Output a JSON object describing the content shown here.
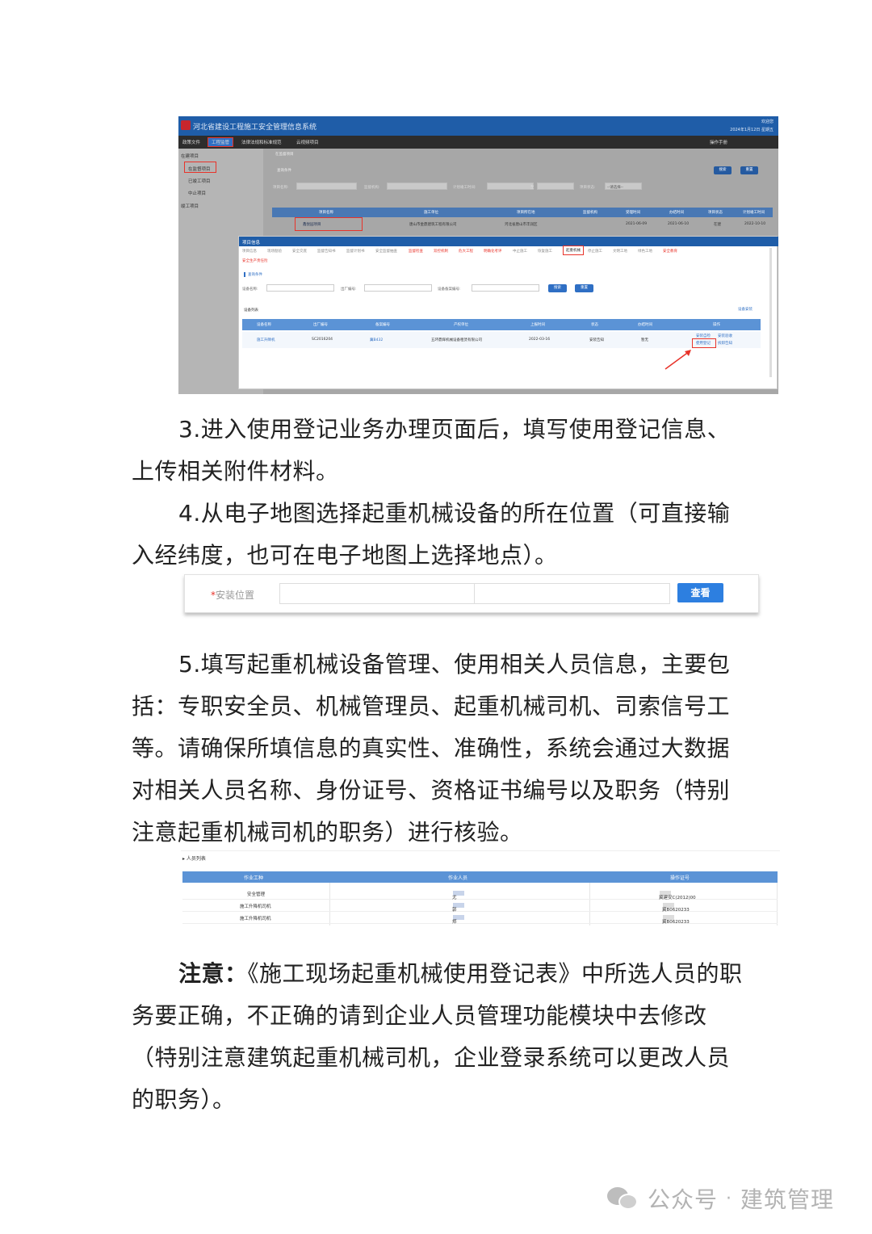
{
  "shot1": {
    "app_title": "河北省建设工程施工安全管理信息系统",
    "top_right_line1": "欢迎您",
    "top_right_line2": "2024年1月12日 星期五",
    "top_right_line3": "操作手册",
    "menu": [
      "政策文件",
      "工程监管",
      "法律法规和标准规范",
      "云视频项目"
    ],
    "menu_active_index": 1,
    "leftnav": [
      "在建项目",
      "在监督项目",
      "已竣工项目",
      "中止项目",
      "竣工项目"
    ],
    "breadcrumb_tab": "在监督项目",
    "query_label": "查询条件",
    "filters": [
      "项目名称:",
      "监督机构:",
      "计划竣工时间:",
      "至",
      "项目状态:",
      "--请选择--"
    ],
    "search_btn": "搜索",
    "reset_btn": "重置",
    "proj_columns": [
      "项目名称",
      "施工单位",
      "项目所在地",
      "监督机构",
      "受理时间",
      "办结时间",
      "项目状态",
      "计划竣工时间"
    ],
    "proj_row": [
      "鑫悦园项目",
      "唐山市金鼎建筑工程有限公司",
      "河北省唐山市丰润区",
      "",
      "2021-06-09",
      "2021-06-10",
      "在建",
      "2022-10-10"
    ],
    "modal_title": "项目信息",
    "modal_tabs": [
      "项目信息",
      "现场勘验",
      "安全交底",
      "监督告知书",
      "监督计划书",
      "安全监督抽查",
      "监督检查",
      "双控机制",
      "危大工程",
      "明确化考评",
      "中止施工",
      "恢复施工",
      "起重机械",
      "停止施工",
      "文明工地",
      "绿色工地",
      "安全教育",
      "安全生产责任险"
    ],
    "modal_tab_red": [
      6,
      7,
      8,
      9,
      16,
      17
    ],
    "modal_tab_active": 12,
    "modal_query_label": "查询条件",
    "modal_filters": [
      "设备名称:",
      "出厂编号:",
      "设备备案编号:"
    ],
    "device_list_label": "设备列表",
    "device_add": "设备安装",
    "device_columns": [
      "设备名称",
      "出厂编号",
      "备案编号",
      "产权单位",
      "上报时间",
      "状态",
      "办结时间",
      "操作"
    ],
    "device_row": [
      "施工升降机",
      "SC2016204",
      "冀B432",
      "五环鼎辉机械设备租赁有限公司",
      "2022-03-16",
      "安装告知",
      "暂无",
      ""
    ],
    "ops": [
      "安装自检",
      "安装验收",
      "使用登记",
      "拆卸告知"
    ]
  },
  "paragraphs": {
    "p3": "3.进入使用登记业务办理页面后，填写使用登记信息、上传相关附件材料。",
    "p4": "4.从电子地图选择起重机械设备的所在位置（可直接输入经纬度，也可在电子地图上选择地点）。",
    "p5": "5.填写起重机械设备管理、使用相关人员信息，主要包括：专职安全员、机械管理员、起重机械司机、司索信号工等。请确保所填信息的真实性、准确性，系统会通过大数据对相关人员名称、身份证号、资格证书编号以及职务（特别注意起重机械司机的职务）进行核验。",
    "note_label": "注意：",
    "note": "《施工现场起重机械使用登记表》中所选人员的职务要正确，不正确的请到企业人员管理功能模块中去修改（特别注意建筑起重机械司机，企业登录系统可以更改人员的职务）。"
  },
  "shot2": {
    "label": "安装位置",
    "button": "查看"
  },
  "shot3": {
    "caption": "人员列表",
    "columns": [
      "作业工种",
      "作业人员",
      "操作证号"
    ],
    "rows": [
      [
        "安全管理",
        "尤",
        "冀建安C(2012)00"
      ],
      [
        "施工升降机司机",
        "郭",
        "冀B0620233"
      ],
      [
        "施工升降机司机",
        "郑",
        "冀B0620233"
      ]
    ]
  },
  "footer": {
    "brand": "公众号",
    "dot": "·",
    "account": "建筑管理"
  },
  "colors": {
    "header_blue": "#1f5da8",
    "table_blue": "#5b93d6",
    "highlight_red": "#e8332a",
    "button_blue": "#2d7fe0"
  }
}
